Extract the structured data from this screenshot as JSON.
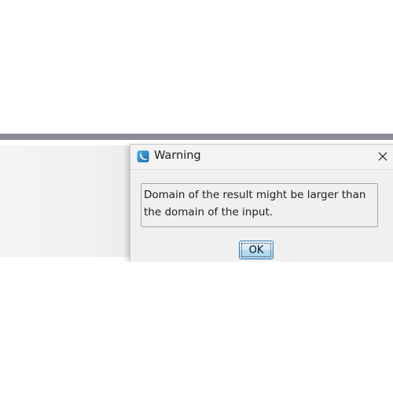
{
  "dialog": {
    "title": "Warning",
    "message": "Domain of the result might be larger than the domain of the input.",
    "ok_label": "OK",
    "close_glyph": "✕",
    "app_icon": "app-logo-icon",
    "close_icon": "close-icon"
  },
  "colors": {
    "background_bar": "#8a8a99",
    "dialog_background": "#f0f0f0",
    "button_border": "#3c7fb1",
    "button_fill": "#b8dbf4",
    "icon_accent": "#1e7fb8"
  }
}
